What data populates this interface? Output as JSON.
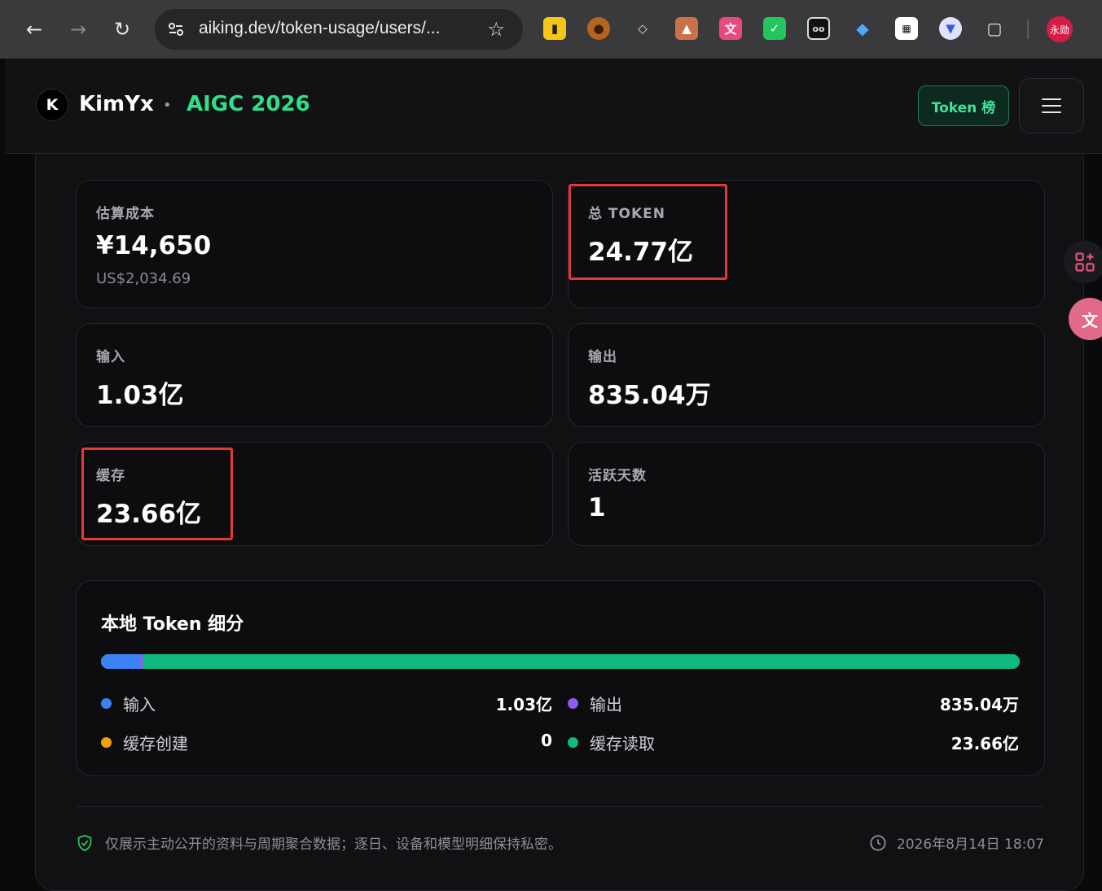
{
  "browser": {
    "url": "aiking.dev/token-usage/users/...",
    "profile_label": "永勋"
  },
  "header": {
    "logo_letter": "K",
    "brand": "KimYx",
    "separator": "•",
    "event": "AIGC 2026",
    "token_button": "Token 榜"
  },
  "stats": {
    "cost": {
      "label": "估算成本",
      "value": "¥14,650",
      "sub": "US$2,034.69"
    },
    "total": {
      "label": "总 TOKEN",
      "value": "24.77亿"
    },
    "input": {
      "label": "输入",
      "value": "1.03亿"
    },
    "output": {
      "label": "输出",
      "value": "835.04万"
    },
    "cache": {
      "label": "缓存",
      "value": "23.66亿"
    },
    "active_days": {
      "label": "活跃天数",
      "value": "1"
    }
  },
  "breakdown": {
    "title": "本地 Token 细分",
    "bar_fractions": {
      "input": 0.042,
      "output": 0.0034,
      "cache_create": 0,
      "cache_read": 0.955
    },
    "items": [
      {
        "name": "输入",
        "value": "1.03亿",
        "color": "#3b82f6"
      },
      {
        "name": "输出",
        "value": "835.04万",
        "color": "#8b5cf6"
      },
      {
        "name": "缓存创建",
        "value": "0",
        "color": "#f59e0b"
      },
      {
        "name": "缓存读取",
        "value": "23.66亿",
        "color": "#10b981"
      }
    ]
  },
  "footer": {
    "privacy_note": "仅展示主动公开的资料与周期聚合数据；逐日、设备和模型明细保持私密。",
    "timestamp": "2026年8月14日 18:07"
  },
  "colors": {
    "accent_green": "#2ee08a",
    "highlight_red": "#e53935"
  }
}
